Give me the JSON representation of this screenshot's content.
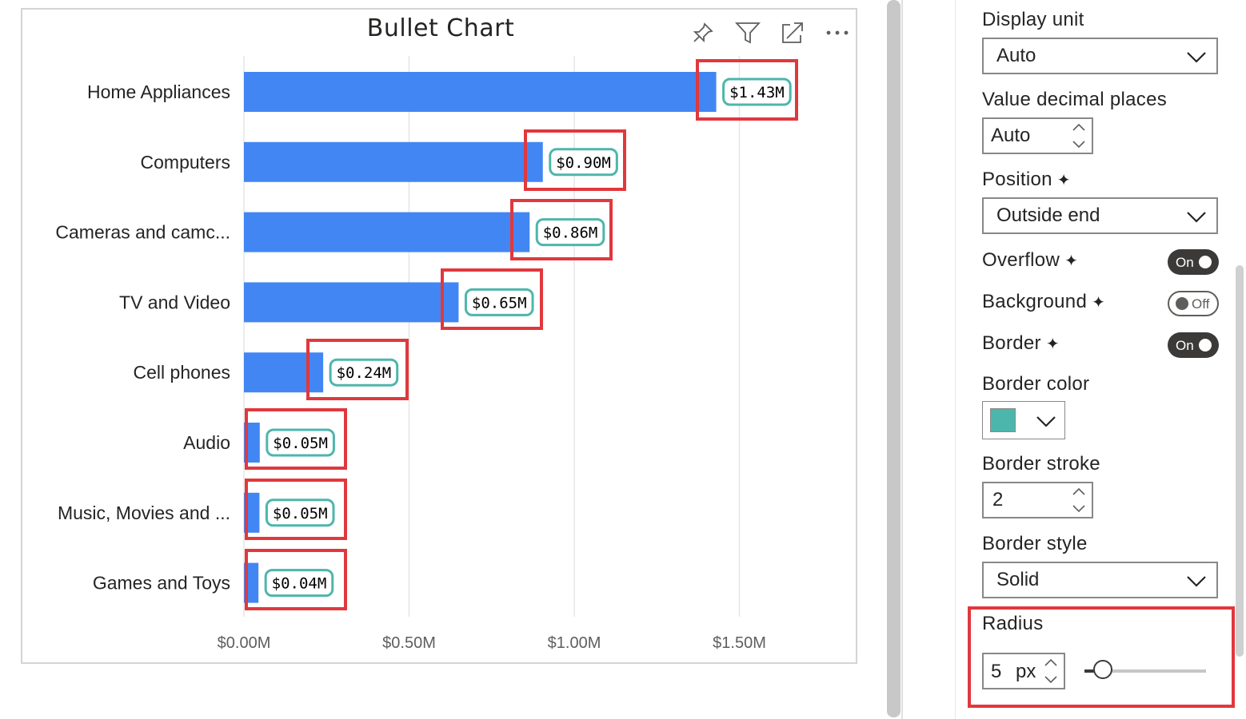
{
  "visual": {
    "title": "Bullet Chart",
    "header_icons": [
      "pin-icon",
      "filter-icon",
      "focus-mode-icon",
      "more-options-icon"
    ]
  },
  "chart_data": {
    "type": "bar",
    "orientation": "horizontal",
    "title": "Bullet Chart",
    "categories": [
      "Home Appliances",
      "Computers",
      "Cameras and camc...",
      "TV and Video",
      "Cell phones",
      "Audio",
      "Music, Movies and ...",
      "Games and Toys"
    ],
    "values": [
      1.43,
      0.905,
      0.865,
      0.65,
      0.24,
      0.048,
      0.047,
      0.044
    ],
    "value_unit": "$M",
    "data_labels": [
      "$1.43M",
      "$0.90M",
      "$0.86M",
      "$0.65M",
      "$0.24M",
      "$0.05M",
      "$0.05M",
      "$0.04M"
    ],
    "x_ticks": [
      0,
      0.5,
      1.0,
      1.5
    ],
    "x_tick_labels": [
      "$0.00M",
      "$0.50M",
      "$1.00M",
      "$1.50M"
    ],
    "xlim": [
      0,
      1.7
    ],
    "grid": true,
    "bar_color": "#4286f4",
    "label_border_color": "#4db6ac",
    "label_position": "Outside end"
  },
  "format_pane": {
    "display_unit": {
      "label": "Display unit",
      "value": "Auto"
    },
    "decimal_places": {
      "label": "Value decimal places",
      "value": "Auto"
    },
    "position": {
      "label": "Position",
      "value": "Outside end"
    },
    "overflow": {
      "label": "Overflow",
      "state": "On"
    },
    "background": {
      "label": "Background",
      "state": "Off"
    },
    "border": {
      "label": "Border",
      "state": "On"
    },
    "border_color": {
      "label": "Border color",
      "value": "#4db6ac"
    },
    "border_stroke": {
      "label": "Border stroke",
      "value": "2"
    },
    "border_style": {
      "label": "Border style",
      "value": "Solid"
    },
    "radius": {
      "label": "Radius",
      "value": "5",
      "unit": "px",
      "slider_fraction": 0.1
    }
  },
  "spark_icon": "✦",
  "highlight_color": "#e0383d"
}
